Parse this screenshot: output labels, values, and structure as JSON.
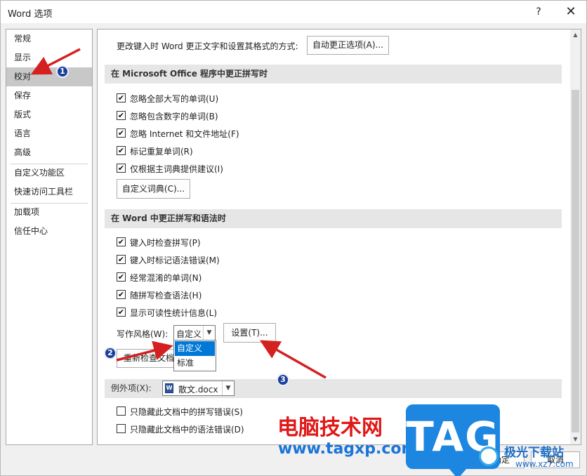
{
  "window": {
    "title": "Word 选项",
    "help": "?",
    "close": "✕"
  },
  "nav": {
    "items": [
      "常规",
      "显示",
      "校对",
      "保存",
      "版式",
      "语言",
      "高级",
      "自定义功能区",
      "快速访问工具栏",
      "加载项",
      "信任中心"
    ],
    "active": "校对"
  },
  "autocorrect": {
    "label": "更改键入时 Word 更正文字和设置其格式的方式:",
    "button": "自动更正选项(A)..."
  },
  "office_section": {
    "title": "在 Microsoft Office 程序中更正拼写时",
    "options": [
      {
        "label": "忽略全部大写的单词(U)",
        "checked": true
      },
      {
        "label": "忽略包含数字的单词(B)",
        "checked": true
      },
      {
        "label": "忽略 Internet 和文件地址(F)",
        "checked": true
      },
      {
        "label": "标记重复单词(R)",
        "checked": true
      },
      {
        "label": "仅根据主词典提供建议(I)",
        "checked": true
      }
    ],
    "custom_dict_button": "自定义词典(C)..."
  },
  "word_section": {
    "title": "在 Word 中更正拼写和语法时",
    "options": [
      {
        "label": "键入时检查拼写(P)",
        "checked": true
      },
      {
        "label": "键入时标记语法错误(M)",
        "checked": true
      },
      {
        "label": "经常混淆的单词(N)",
        "checked": true
      },
      {
        "label": "随拼写检查语法(H)",
        "checked": true
      },
      {
        "label": "显示可读性统计信息(L)",
        "checked": true
      }
    ],
    "writing_style_label": "写作风格(W):",
    "writing_style_value": "自定义",
    "writing_style_options": [
      "自定义",
      "标准"
    ],
    "settings_button": "设置(T)...",
    "recheck_button": "重新检查文档(K)"
  },
  "exceptions": {
    "label": "例外项(X):",
    "document": "散文.docx",
    "options": [
      {
        "label": "只隐藏此文档中的拼写错误(S)",
        "checked": false
      },
      {
        "label": "只隐藏此文档中的语法错误(D)",
        "checked": false
      }
    ]
  },
  "footer": {
    "ok": "确定",
    "cancel": "取消"
  },
  "annotations": {
    "badges": [
      "1",
      "2",
      "3"
    ],
    "arrow_color": "#d42020"
  },
  "watermark": {
    "site_name": "电脑技术网",
    "url": "www.tagxp.com",
    "logo": "TAG",
    "brand2": "极光下载站",
    "brand2_url": "www.xz7.com"
  },
  "colors": {
    "accent": "#0078d7",
    "badge": "#1a3f9a",
    "watermark_red": "#e01818",
    "watermark_blue": "#1b74d8"
  }
}
